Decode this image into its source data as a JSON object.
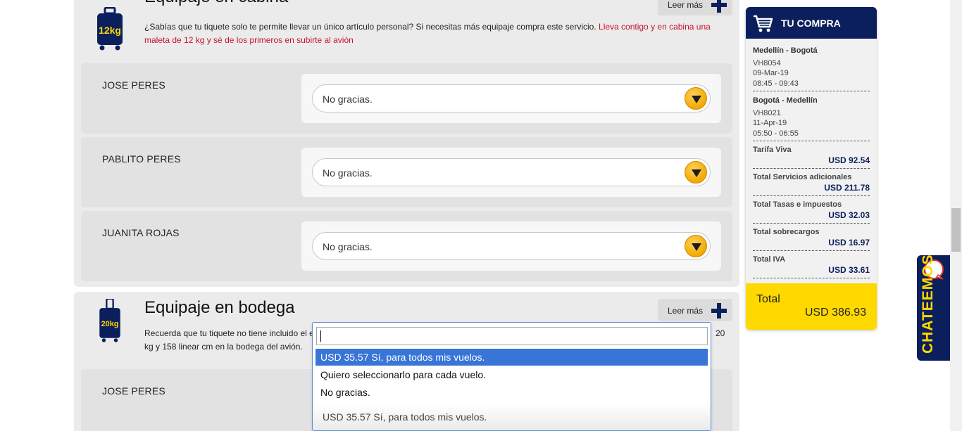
{
  "cabina": {
    "title": "Equipaje en cabina",
    "bag_label": "12kg",
    "desc_plain": "¿Sabías que tu tiquete solo te permite llevar un único artículo personal? Si necesitas más equipaje compra este servicio. ",
    "desc_highlight": "Lleva contigo y en cabina una maleta de 12 kg y sé de los primeros en subirte al avión",
    "leer_mas": "Leer más",
    "passengers": [
      {
        "name": "JOSE PERES",
        "selection": "No gracias."
      },
      {
        "name": "PABLITO PERES",
        "selection": "No gracias."
      },
      {
        "name": "JUANITA ROJAS",
        "selection": "No gracias."
      }
    ]
  },
  "bodega": {
    "title": "Equipaje en bodega",
    "bag_label": "20kg",
    "desc_start": "Recuerda que tu tiquete no tiene incluido el e",
    "desc_end": "20",
    "desc_line2": "kg y 158 linear cm en la bodega del avión.",
    "leer_mas": "Leer más",
    "passengers": [
      {
        "name": "JOSE PERES",
        "selection": "USD 35.57 Sí, para todos mis vuelos."
      }
    ],
    "dropdown": {
      "search_value": "",
      "options": [
        "USD 35.57 Sí, para todos mis vuelos.",
        "Quiero seleccionarlo para cada vuelo.",
        "No gracias."
      ],
      "highlighted_index": 0
    }
  },
  "cart": {
    "title": "TU COMPRA",
    "legs": [
      {
        "route": "Medellín - Bogotá",
        "flight": "VH8054",
        "date": "09-Mar-19",
        "time": "08:45 - 09:43"
      },
      {
        "route": "Bogotá - Medellín",
        "flight": "VH8021",
        "date": "11-Apr-19",
        "time": "05:50 - 06:55"
      }
    ],
    "costs": [
      {
        "label": "Tarifa Viva",
        "value": "USD 92.54"
      },
      {
        "label": "Total Servicios adicionales",
        "value": "USD 211.78"
      },
      {
        "label": "Total Tasas e impuestos",
        "value": "USD 32.03"
      },
      {
        "label": "Total sobrecargos",
        "value": "USD 16.97"
      },
      {
        "label": "Total IVA",
        "value": "USD 33.61"
      }
    ],
    "total_label": "Total",
    "total_value": "USD 386.93"
  },
  "chat": {
    "label": "CHATEEMOS"
  },
  "colors": {
    "brand_navy": "#0b1f5c",
    "brand_yellow": "#ffd800",
    "highlight_red": "#c8102e",
    "select_blue": "#3875d7"
  }
}
